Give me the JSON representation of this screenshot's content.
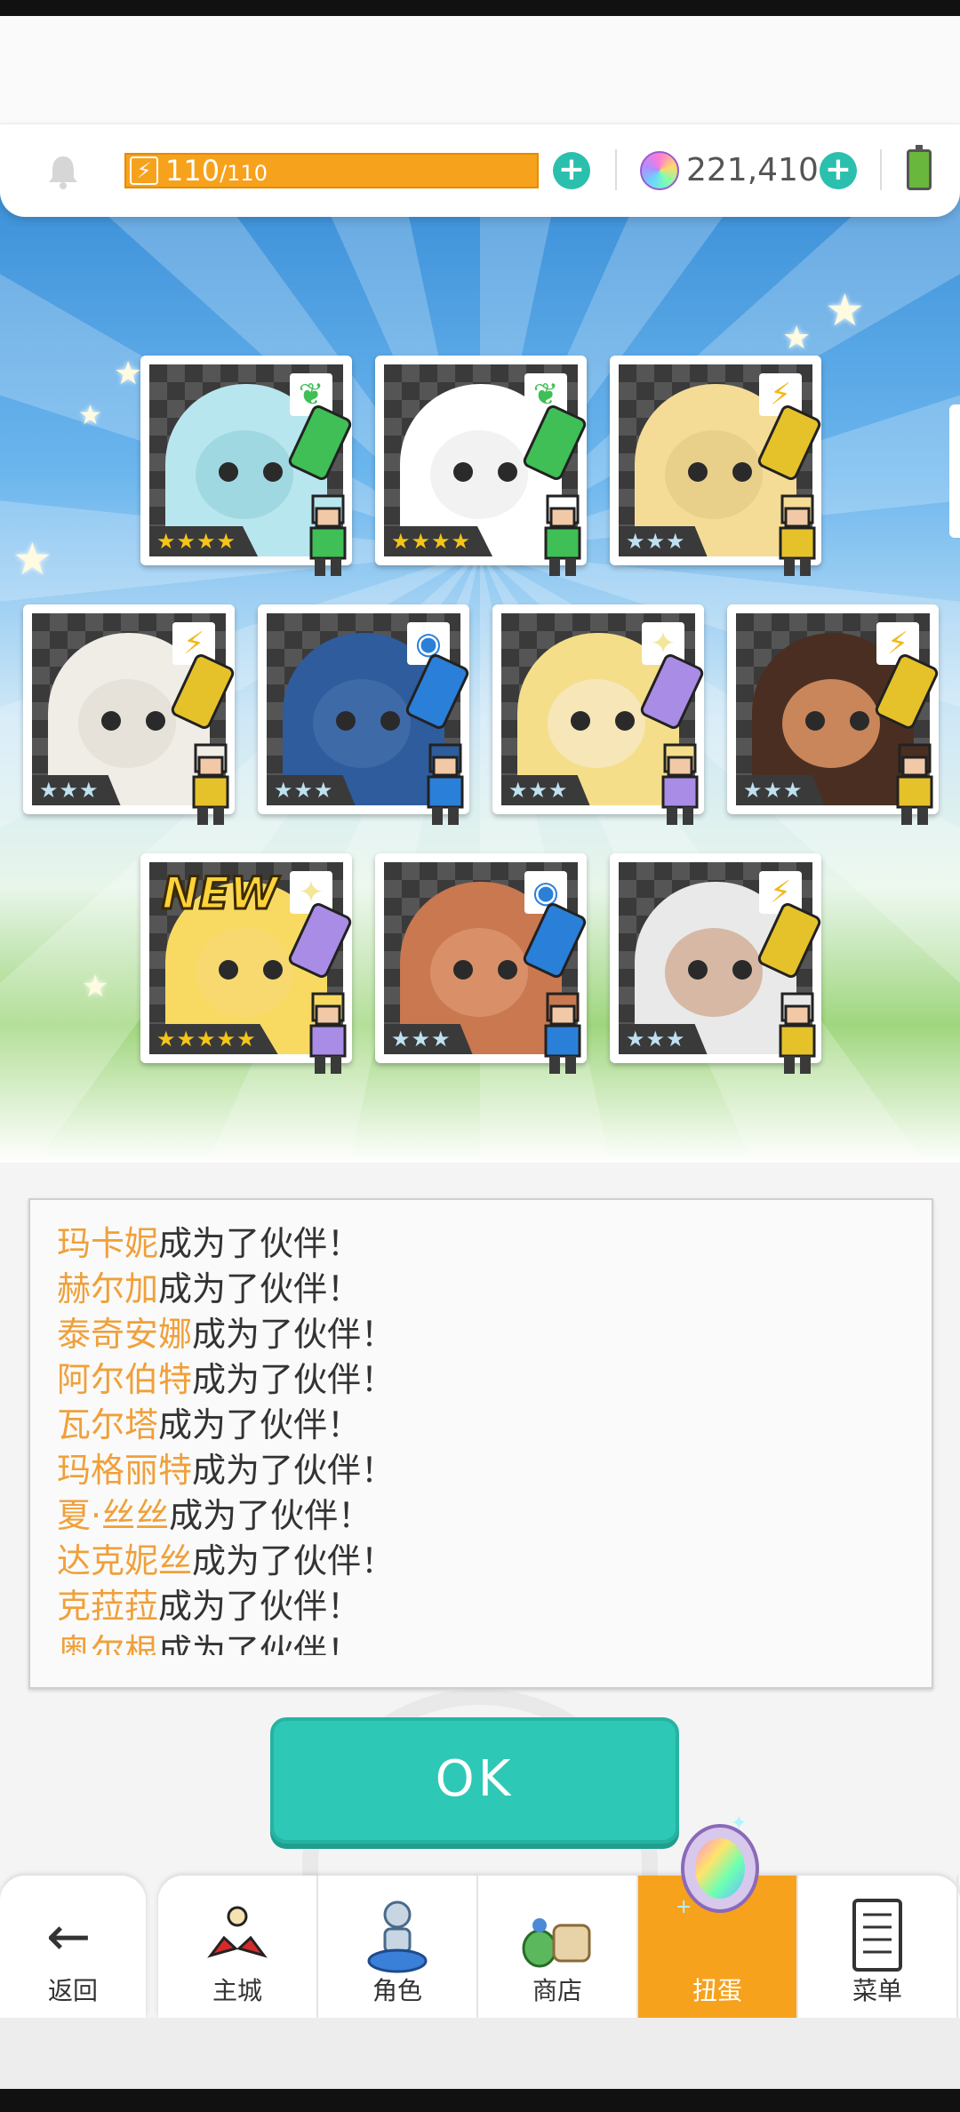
{
  "status": {
    "stamina_current": "110",
    "stamina_sep_max": "/110",
    "stamina_fraction": 1.0,
    "gems": "221,410"
  },
  "colors": {
    "accent_teal": "#2ec8b6",
    "accent_orange": "#f7a21d",
    "name_orange": "#f0a03a"
  },
  "cards": [
    {
      "element_icon": "leaf-icon",
      "stars": "★★★★",
      "portrait_color": "#9fd8e0",
      "hair": "#b8e6ee",
      "crystal": "#3fbf55"
    },
    {
      "element_icon": "leaf-icon",
      "stars": "★★★★",
      "portrait_color": "#f2f2f2",
      "hair": "#ffffff",
      "crystal": "#3fbf55"
    },
    {
      "element_icon": "lightning-icon",
      "stars": "★★★",
      "portrait_color": "#e8cf8a",
      "hair": "#f4dc96",
      "crystal": "#e6c22a"
    },
    {
      "element_icon": "lightning-icon",
      "stars": "★★★",
      "portrait_color": "#e6e2da",
      "hair": "#f0ece6",
      "crystal": "#e6c22a"
    },
    {
      "element_icon": "water-icon",
      "stars": "★★★",
      "portrait_color": "#3e6aa8",
      "hair": "#2f5c9c",
      "crystal": "#2a7fd8"
    },
    {
      "element_icon": "sparkle-icon",
      "stars": "★★★",
      "portrait_color": "#f6e6b8",
      "hair": "#f5de8a",
      "crystal": "#a98ce6"
    },
    {
      "element_icon": "lightning-icon",
      "stars": "★★★",
      "portrait_color": "#c8865a",
      "hair": "#4a2e22",
      "crystal": "#e6c22a"
    },
    {
      "element_icon": "sparkle-icon",
      "stars": "★★★★★",
      "portrait_color": "#f7d970",
      "hair": "#f8da62",
      "crystal": "#a98ce6",
      "is_new": true
    },
    {
      "element_icon": "water-icon",
      "stars": "★★★",
      "portrait_color": "#d99068",
      "hair": "#c9784f",
      "crystal": "#2a7fd8"
    },
    {
      "element_icon": "lightning-icon",
      "stars": "★★★",
      "portrait_color": "#d6b8a4",
      "hair": "#e9e9e9",
      "crystal": "#e6c22a"
    }
  ],
  "new_label": "NEW",
  "messages": [
    {
      "name": "玛卡妮",
      "suffix": "成为了伙伴！"
    },
    {
      "name": "赫尔加",
      "suffix": "成为了伙伴！"
    },
    {
      "name": "泰奇安娜",
      "suffix": "成为了伙伴！"
    },
    {
      "name": "阿尔伯特",
      "suffix": "成为了伙伴！"
    },
    {
      "name": "瓦尔塔",
      "suffix": "成为了伙伴！"
    },
    {
      "name": "玛格丽特",
      "suffix": "成为了伙伴！"
    },
    {
      "name": "夏·丝丝",
      "suffix": "成为了伙伴！"
    },
    {
      "name": "达克妮丝",
      "suffix": "成为了伙伴！"
    },
    {
      "name": "克菈菈",
      "suffix": "成为了伙伴！"
    },
    {
      "name": "奥尔根",
      "suffix": "成为了伙伴！"
    }
  ],
  "ok_label": "OK",
  "nav": {
    "back": "返回",
    "items": [
      {
        "label": "主城",
        "icon": "castle-icon"
      },
      {
        "label": "角色",
        "icon": "character-icon"
      },
      {
        "label": "商店",
        "icon": "shop-icon"
      },
      {
        "label": "扭蛋",
        "icon": "gacha-icon",
        "active": true
      },
      {
        "label": "菜单",
        "icon": "menu-icon"
      }
    ]
  }
}
